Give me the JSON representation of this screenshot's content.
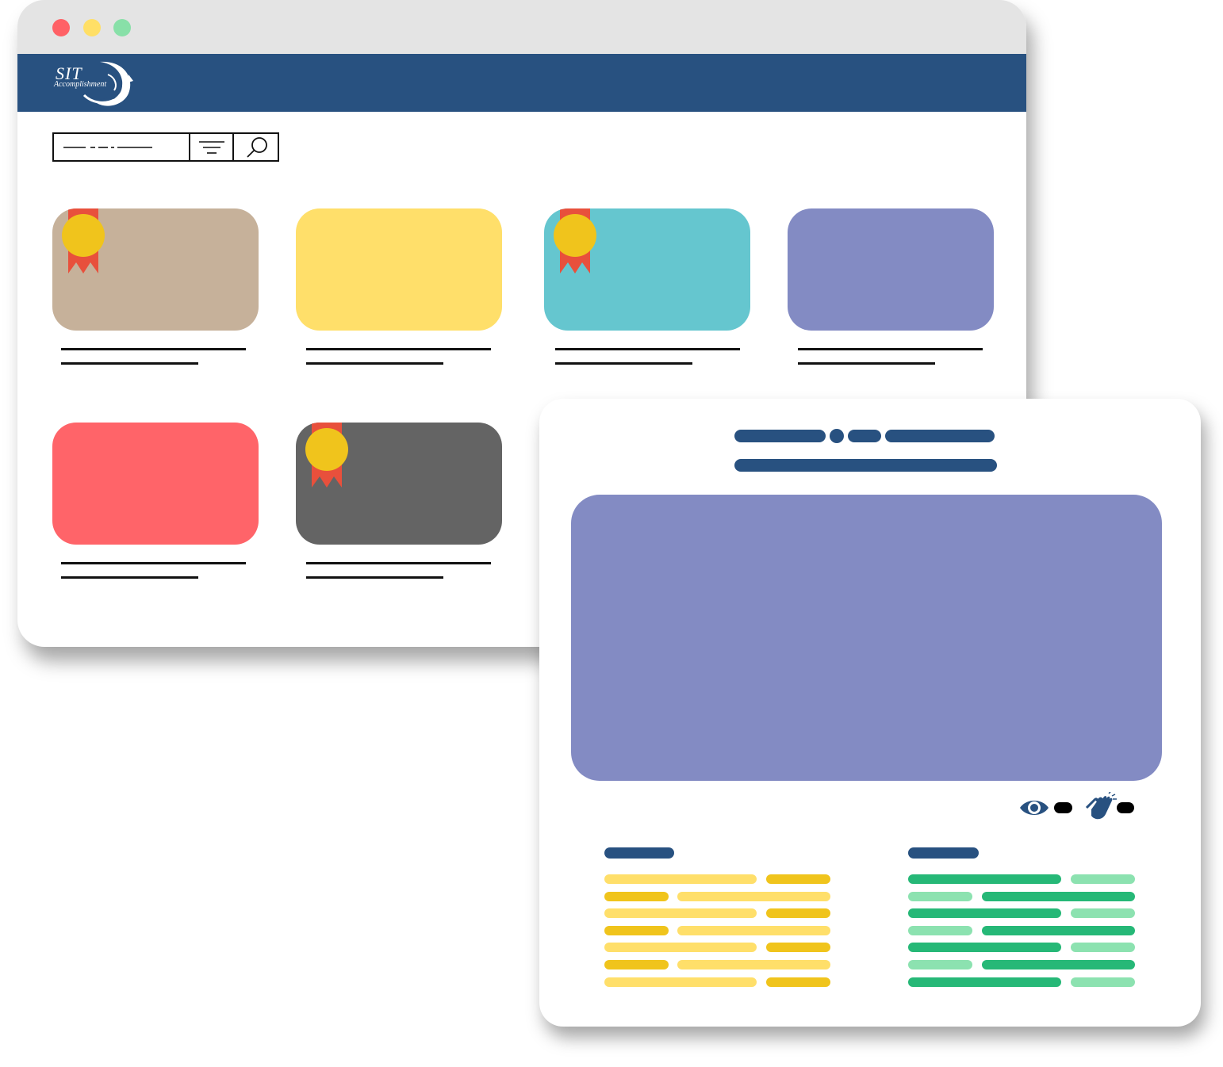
{
  "app": {
    "logo_text": "SIT",
    "logo_subtext": "Accomplishment"
  },
  "colors": {
    "titlebar": "#e4e4e4",
    "navbar": "#285180",
    "dot_close": "#ff6166",
    "dot_min": "#ffdf66",
    "dot_max": "#88e0a8",
    "ribbon": "#e8503c",
    "medal": "#f0c41c",
    "hero": "#838bc3",
    "heading_pill": "#285180",
    "yellow_dark": "#f0c41c",
    "yellow_light": "#ffdf6a",
    "green_dark": "#26b877",
    "green_light": "#8ce2b0"
  },
  "search": {
    "icons": [
      "filter-icon",
      "search-icon"
    ]
  },
  "cards": [
    {
      "color": "#c6b19a",
      "awarded": true
    },
    {
      "color": "#ffdf6a",
      "awarded": false
    },
    {
      "color": "#65c6cf",
      "awarded": true
    },
    {
      "color": "#838bc3",
      "awarded": false
    },
    {
      "color": "#ff6469",
      "awarded": false
    },
    {
      "color": "#646464",
      "awarded": true
    }
  ],
  "detail": {
    "stats_icons": [
      "eye-icon",
      "clap-icon"
    ]
  }
}
